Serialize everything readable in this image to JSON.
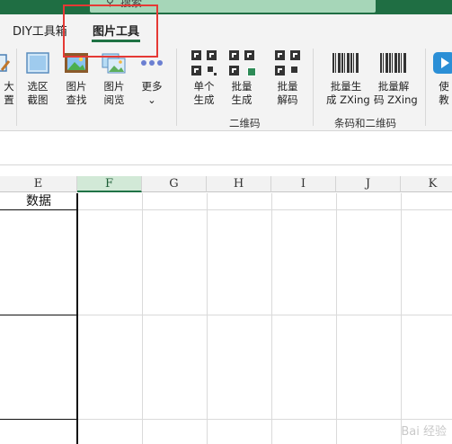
{
  "search": {
    "text": "搜索"
  },
  "tabs": [
    {
      "label": "DIY工具箱"
    },
    {
      "label": "图片工具"
    }
  ],
  "ribbon": {
    "partial_left": {
      "line1": "大",
      "line2": "置"
    },
    "buttons": [
      {
        "line1": "选区",
        "line2": "截图"
      },
      {
        "line1": "图片",
        "line2": "查找"
      },
      {
        "line1": "图片",
        "line2": "阅览"
      },
      {
        "line1": "更多",
        "line2": "⌄"
      },
      {
        "line1": "单个",
        "line2": "生成"
      },
      {
        "line1": "批量",
        "line2": "生成"
      },
      {
        "line1": "批量",
        "line2": "解码"
      },
      {
        "line1": "批量生",
        "line2": "成 ZXing"
      },
      {
        "line1": "批量解",
        "line2": "码 ZXing"
      },
      {
        "line1": "使",
        "line2": "教"
      }
    ],
    "groups": [
      {
        "label": "二维码"
      },
      {
        "label": "条码和二维码"
      }
    ]
  },
  "sheet": {
    "columns": [
      "E",
      "F",
      "G",
      "H",
      "I",
      "J",
      "K"
    ],
    "selected_column": "F",
    "header_cell": "数据"
  },
  "watermark": "Bai 经验"
}
